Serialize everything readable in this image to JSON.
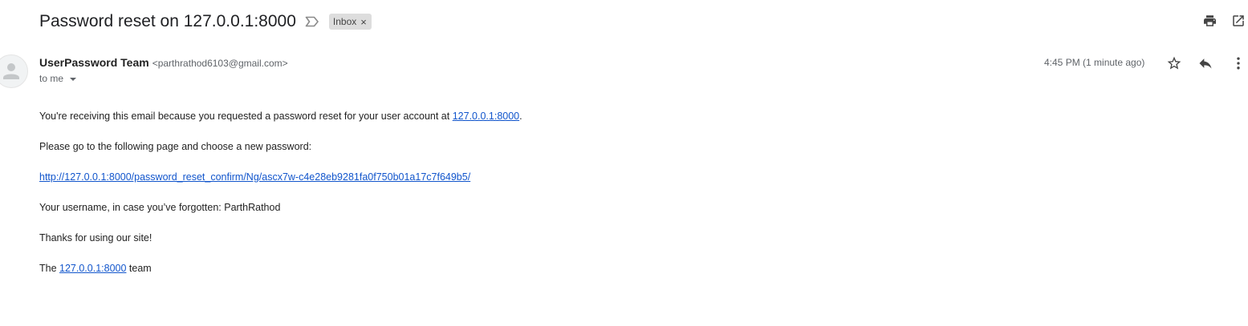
{
  "header": {
    "subject": "Password reset on 127.0.0.1:8000",
    "label": "Inbox",
    "label_close": "×",
    "icons": {
      "importance": "importance-marker-icon",
      "print": "print-icon",
      "open_new_window": "open-in-new-window-icon"
    }
  },
  "message": {
    "sender_name": "UserPassword Team",
    "sender_email": "<parthrathod6103@gmail.com>",
    "recipient": "to me",
    "timestamp": "4:45 PM (1 minute ago)",
    "actions": {
      "star": "star-icon",
      "reply": "reply-icon",
      "more": "more-vertical-icon"
    },
    "avatar_icon": "person-avatar-icon"
  },
  "body": {
    "p1_prefix": "You're receiving this email because you requested a password reset for your user account at ",
    "p1_link": "127.0.0.1:8000",
    "p1_suffix": ".",
    "p2": "Please go to the following page and choose a new password:",
    "reset_link": "http://127.0.0.1:8000/password_reset_confirm/Ng/ascx7w-c4e28eb9281fa0f750b01a17c7f649b5/",
    "p4": "Your username, in case you’ve forgotten: ParthRathod",
    "p5": "Thanks for using our site!",
    "p6_prefix": "The ",
    "p6_link": "127.0.0.1:8000",
    "p6_suffix": " team"
  },
  "colors": {
    "link": "#1155cc",
    "secondary_text": "#5f6368",
    "chip_bg": "#dddddd"
  }
}
